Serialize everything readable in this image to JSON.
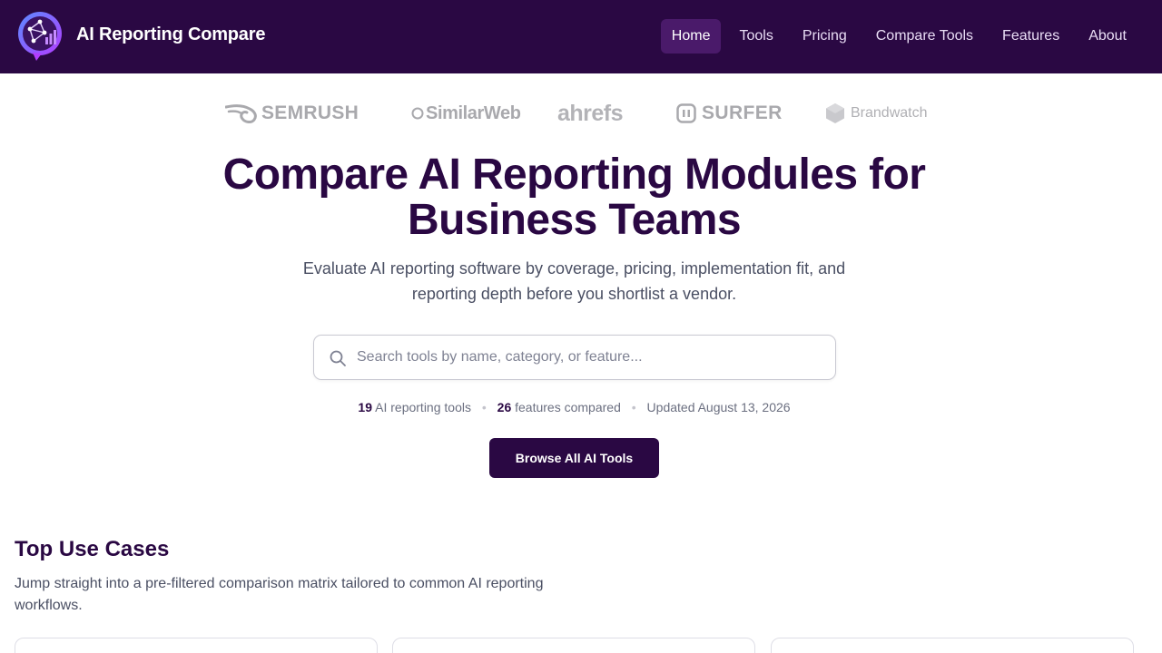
{
  "brand": {
    "name": "AI Reporting Compare",
    "logo_icon": "network-chart-icon",
    "colors": {
      "primary": "#2a0843",
      "nav_active": "#4a1a6a",
      "logo_gradient_start": "#5b8cff",
      "logo_gradient_end": "#b23cff"
    }
  },
  "nav": {
    "items": [
      {
        "label": "Home",
        "active": true
      },
      {
        "label": "Tools",
        "active": false
      },
      {
        "label": "Pricing",
        "active": false
      },
      {
        "label": "Compare Tools",
        "active": false
      },
      {
        "label": "Features",
        "active": false
      },
      {
        "label": "About",
        "active": false
      }
    ]
  },
  "partners": [
    {
      "name": "SEMRUSH",
      "icon": "semrush-flame-icon"
    },
    {
      "name": "SimilarWeb",
      "icon": "similarweb-icon"
    },
    {
      "name": "ahrefs",
      "icon": ""
    },
    {
      "name": "SURFER",
      "icon": "surfer-icon"
    },
    {
      "name": "Brandwatch",
      "icon": "brandwatch-hexagon-icon"
    }
  ],
  "hero": {
    "title_line1": "Compare AI Reporting Modules for",
    "title_line2": "Business Teams",
    "subtitle": "Evaluate AI reporting software by coverage, pricing, implementation fit, and reporting depth before you shortlist a vendor."
  },
  "search": {
    "placeholder": "Search tools by name, category, or feature...",
    "value": "",
    "icon": "search-icon"
  },
  "stats": {
    "tools_count": "19",
    "tools_label": "AI reporting tools",
    "features_count": "26",
    "features_label": "features compared",
    "updated": "Updated August 13, 2026",
    "separator": "•"
  },
  "cta": {
    "browse_label": "Browse All AI Tools"
  },
  "use_cases": {
    "title": "Top Use Cases",
    "subtitle": "Jump straight into a pre-filtered comparison matrix tailored to common AI reporting workflows."
  }
}
